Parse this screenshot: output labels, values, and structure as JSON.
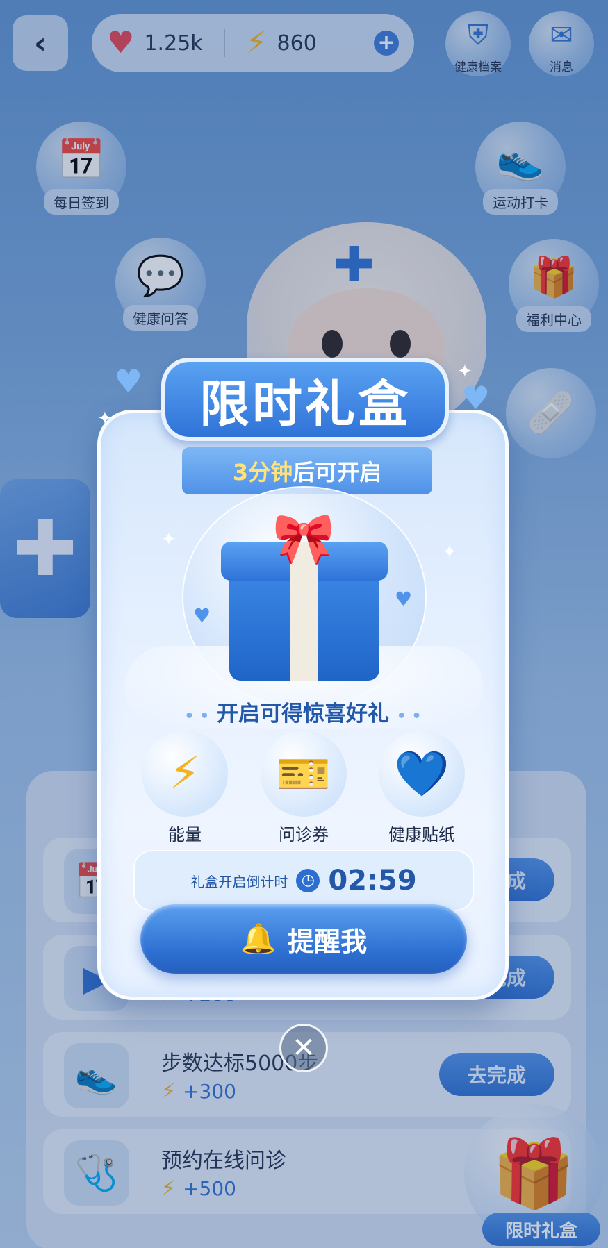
{
  "header": {
    "back_icon": "chevron-left-icon",
    "health_points": "1.25k",
    "energy": "860",
    "add_icon": "plus-icon",
    "health_record_label": "健康档案",
    "messages_label": "消息"
  },
  "bubbles": {
    "daily_checkin": "每日签到",
    "exercise_checkin": "运动打卡",
    "health_qa": "健康问答",
    "welfare_center": "福利中心"
  },
  "tasks": [
    {
      "title": "",
      "reward": "",
      "button": "去完成"
    },
    {
      "title": "",
      "reward": "+200",
      "button": "去完成"
    },
    {
      "title": "步数达标5000步",
      "reward": "+300",
      "button": "去完成"
    },
    {
      "title": "预约在线问诊",
      "reward": "+500",
      "button": ""
    }
  ],
  "corner_gift_label": "限时礼盒",
  "modal": {
    "title": "限时礼盒",
    "ribbon_highlight": "3分钟",
    "ribbon_text": "后可开启",
    "reward_heading": "开启可得惊喜好礼",
    "rewards": [
      {
        "label": "能量",
        "icon": "lightning-icon"
      },
      {
        "label": "问诊券",
        "icon": "ticket-plus-icon"
      },
      {
        "label": "健康贴纸",
        "icon": "smiling-heart-icon"
      }
    ],
    "countdown_label": "礼盒开启倒计时",
    "countdown_time": "02:59",
    "remind_button": "提醒我"
  },
  "colors": {
    "primary_blue": "#2c6fd1",
    "energy_yellow": "#f6b21b",
    "heart_red": "#e8414f"
  }
}
